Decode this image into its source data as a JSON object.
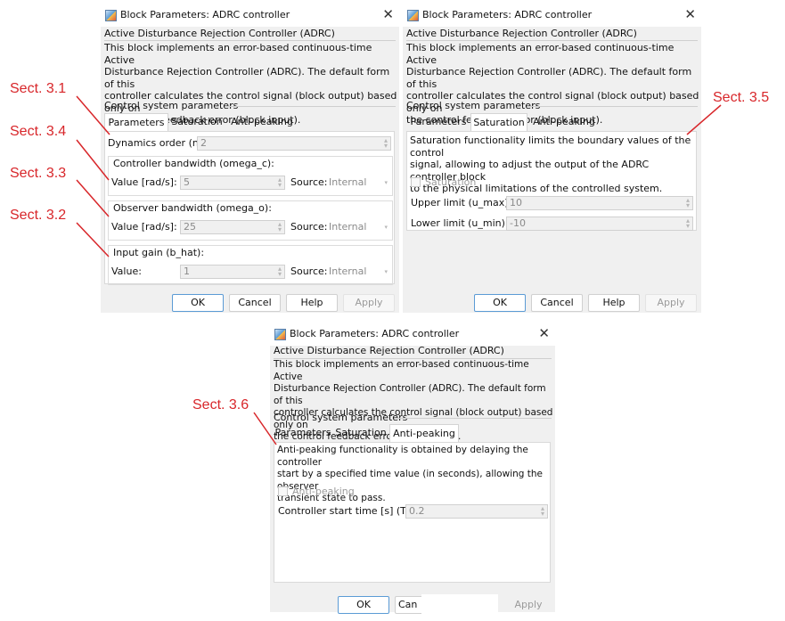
{
  "dialog": {
    "title": "Block Parameters: ADRC controller",
    "close_glyph": "✕",
    "block_name": "Active Disturbance Rejection Controller (ADRC)",
    "description_lines": [
      "This block implements an error-based continuous-time Active",
      "Disturbance Rejection Controller (ADRC). The default form of this",
      "controller calculates the control signal (block output) based only on",
      "the control feedback error (block input)."
    ],
    "section_label": "Control system parameters",
    "tabs": [
      "Parameters",
      "Saturation",
      "Anti-peaking"
    ],
    "buttons": {
      "ok": "OK",
      "cancel": "Cancel",
      "help": "Help",
      "apply": "Apply",
      "cancel_partial": "Can"
    }
  },
  "parameters_tab": {
    "dynamics_order_label": "Dynamics order (n):",
    "dynamics_order_value": "2",
    "controller_bandwidth": {
      "title": "Controller bandwidth (omega_c):",
      "value_label": "Value [rad/s]:",
      "value": "5",
      "source_label": "Source:",
      "source_value": "Internal"
    },
    "observer_bandwidth": {
      "title": "Observer bandwidth (omega_o):",
      "value_label": "Value [rad/s]:",
      "value": "25",
      "source_label": "Source:",
      "source_value": "Internal"
    },
    "input_gain": {
      "title": "Input gain (b_hat):",
      "value_label": "Value:",
      "value": "1",
      "source_label": "Source:",
      "source_value": "Internal"
    }
  },
  "saturation_tab": {
    "description_lines": [
      "Saturation functionality limits the boundary values of the control",
      "signal, allowing to adjust the output of the ADRC controller block",
      "to the physical limitations of the controlled system."
    ],
    "checkbox_label": "Saturation",
    "upper_label": "Upper limit (u_max):",
    "upper_value": "10",
    "lower_label": "Lower limit (u_min):",
    "lower_value": "-10"
  },
  "antipeaking_tab": {
    "description_lines": [
      "Anti-peaking functionality is obtained by delaying the controller",
      "start by a specified time value (in seconds), allowing the observer",
      "transient state to pass."
    ],
    "checkbox_label": "Anti-peaking",
    "start_time_label": "Controller start time [s] (T_d):",
    "start_time_value": "0.2"
  },
  "annotations": {
    "sect_3_1": "Sect. 3.1",
    "sect_3_4": "Sect. 3.4",
    "sect_3_3": "Sect. 3.3",
    "sect_3_2": "Sect. 3.2",
    "sect_3_5": "Sect. 3.5",
    "sect_3_6": "Sect. 3.6",
    "color": "#d8262a"
  },
  "icons": {
    "app_icon": "simulink-block-icon",
    "close": "close-icon",
    "spinner": "spinner-icon",
    "dropdown": "chevron-down-icon"
  }
}
